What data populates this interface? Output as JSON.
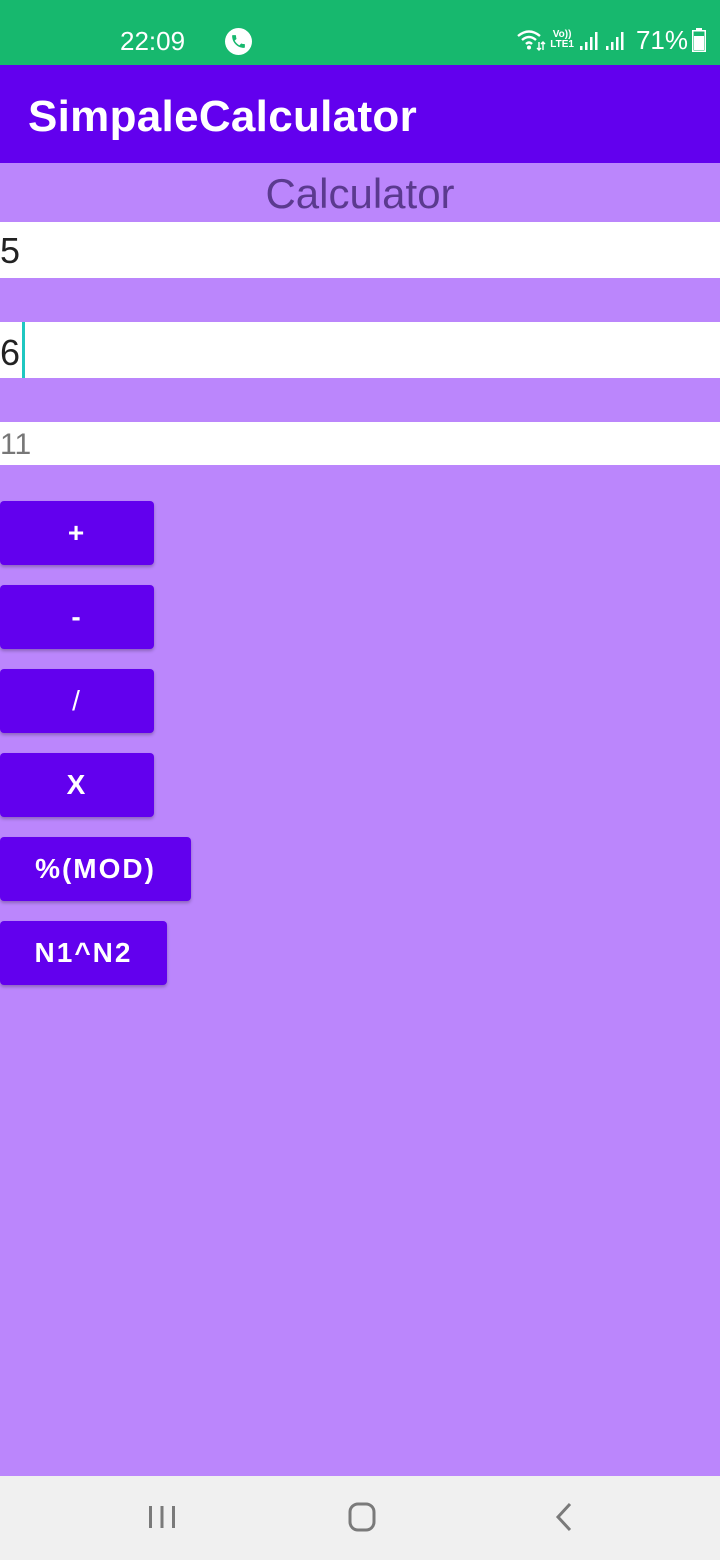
{
  "status_bar": {
    "time": "22:09",
    "lte_top": "Vo))",
    "lte_bottom": "LTE1",
    "battery": "71%"
  },
  "app_bar": {
    "title": "SimpaleCalculator"
  },
  "screen": {
    "heading": "Calculator"
  },
  "inputs": {
    "first_number": "5",
    "second_number": "6",
    "result": "11"
  },
  "operations": {
    "add": "+",
    "subtract": "-",
    "divide": "/",
    "multiply": "X",
    "modulo": "%(MOD)",
    "power": "N1^N2"
  },
  "colors": {
    "status_bar": "#17b86e",
    "app_bar": "#6200ee",
    "background": "#bb86fc",
    "button": "#6200ee",
    "cursor": "#1fc7c1"
  },
  "icons": {
    "status": [
      "call-icon",
      "wifi-icon",
      "signal-icon",
      "battery-icon"
    ],
    "nav": [
      "recents-icon",
      "home-icon",
      "back-icon"
    ]
  }
}
